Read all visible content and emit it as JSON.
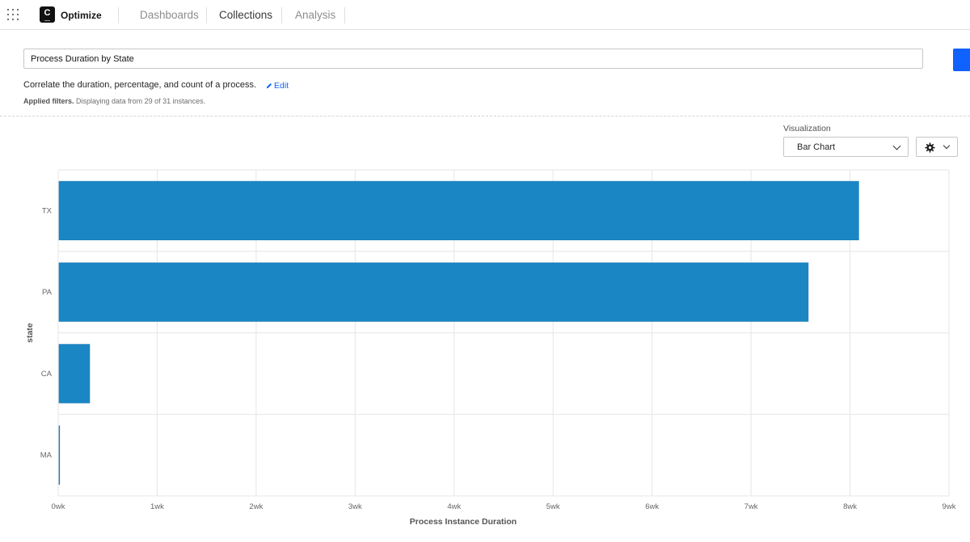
{
  "header": {
    "brand": "Optimize",
    "logo_letter": "C",
    "tabs": [
      {
        "label": "Dashboards",
        "active": false
      },
      {
        "label": "Collections",
        "active": true
      },
      {
        "label": "Analysis",
        "active": false
      }
    ]
  },
  "report": {
    "title": "Process Duration by State",
    "description": "Correlate the duration, percentage, and count of a process.",
    "edit_label": "Edit",
    "filters_bold": "Applied filters.",
    "filters_text": "Displaying data from 29 of 31 instances."
  },
  "controls": {
    "visualization_label": "Visualization",
    "visualization_value": "Bar Chart"
  },
  "colors": {
    "bar": "#1a86c4",
    "accent": "#0f62fe"
  },
  "icons": {
    "apps": "grid-icon",
    "edit": "pencil-icon",
    "settings": "gear-icon",
    "dropdown": "chevron-down-icon"
  },
  "chart_data": {
    "type": "bar",
    "orientation": "horizontal",
    "categories": [
      "TX",
      "PA",
      "CA",
      "MA"
    ],
    "values": [
      8.08,
      7.57,
      0.31,
      0.0
    ],
    "x_unit": "wk",
    "xlim": [
      0,
      9
    ],
    "x_ticks": [
      "0wk",
      "1wk",
      "2wk",
      "3wk",
      "4wk",
      "5wk",
      "6wk",
      "7wk",
      "8wk",
      "9wk"
    ],
    "xlabel": "Process Instance Duration",
    "ylabel": "state",
    "grid": true,
    "legend": "none"
  }
}
